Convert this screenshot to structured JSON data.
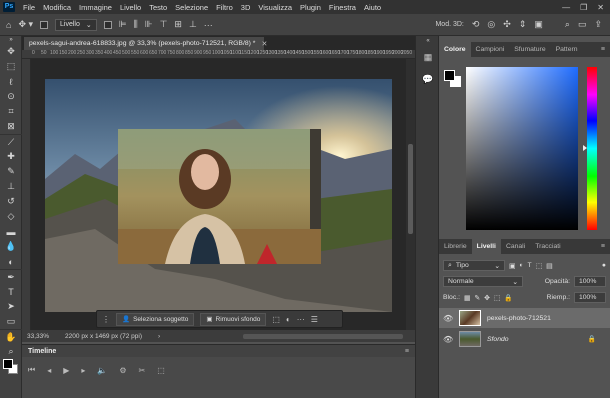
{
  "menubar": {
    "logo": "Ps",
    "items": [
      "File",
      "Modifica",
      "Immagine",
      "Livello",
      "Testo",
      "Selezione",
      "Filtro",
      "3D",
      "Visualizza",
      "Plugin",
      "Finestra",
      "Aiuto"
    ],
    "window_controls": [
      "—",
      "❐",
      "✕"
    ]
  },
  "optionsbar": {
    "autoselect_value": "Livello",
    "mode3d_label": "Mod. 3D:"
  },
  "document": {
    "tab_title": "pexels-sagui-andrea-618833.jpg @ 33,3% (pexels-photo-712521, RGB/8) *",
    "ruler_ticks": [
      "0",
      "50",
      "100",
      "150",
      "200",
      "250",
      "300",
      "350",
      "400",
      "450",
      "500",
      "550",
      "600",
      "650",
      "700",
      "750",
      "800",
      "850",
      "900",
      "950",
      "1000",
      "1050",
      "1100",
      "1150",
      "1200",
      "1250",
      "1300",
      "1350",
      "1400",
      "1450",
      "1500",
      "1550",
      "1600",
      "1650",
      "1700",
      "1750",
      "1800",
      "1850",
      "1900",
      "1950",
      "2000",
      "2050"
    ]
  },
  "contextbar": {
    "select_subject": "Seleziona soggetto",
    "remove_bg": "Rimuovi sfondo"
  },
  "statusbar": {
    "zoom": "33,33%",
    "doc_size": "2200 px x 1469 px (72 ppi)"
  },
  "timeline": {
    "title": "Timeline"
  },
  "color_panel": {
    "tabs": [
      "Colore",
      "Campioni",
      "Sfumature",
      "Pattern"
    ],
    "active_tab": "Colore",
    "foreground": "#000000",
    "background": "#ffffff"
  },
  "layers_panel": {
    "tabs": [
      "Librerie",
      "Livelli",
      "Canali",
      "Tracciati"
    ],
    "active_tab": "Livelli",
    "filter_label": "Tipo",
    "blend_mode": "Normale",
    "opacity_label": "Opacità:",
    "opacity_value": "100%",
    "lock_label": "Bloc.:",
    "fill_label": "Riemp.:",
    "fill_value": "100%",
    "layers": [
      {
        "name": "pexels-photo-712521",
        "selected": true
      },
      {
        "name": "Sfondo",
        "selected": false,
        "locked": true
      }
    ]
  }
}
